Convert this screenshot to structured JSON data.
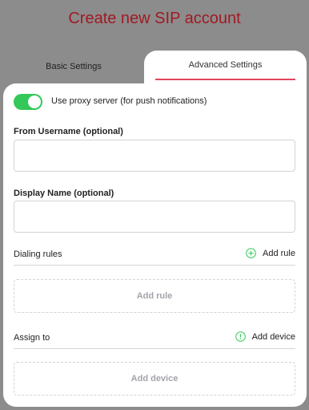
{
  "page_title": "Create new SIP account",
  "tabs": {
    "basic": "Basic Settings",
    "advanced": "Advanced Settings"
  },
  "proxy": {
    "label": "Use proxy server (for push notifications)",
    "enabled": true
  },
  "from_username": {
    "label": "From Username (optional)",
    "value": ""
  },
  "display_name": {
    "label": "Display Name (optional)",
    "value": ""
  },
  "dialing_rules": {
    "title": "Dialing rules",
    "action": "Add rule",
    "placeholder": "Add rule",
    "icon": "plus-circle-icon"
  },
  "assign_to": {
    "title": "Assign to",
    "action": "Add device",
    "placeholder": "Add device",
    "icon": "info-circle-icon"
  },
  "colors": {
    "title": "#a01a23",
    "accent": "#e4465e",
    "toggle_on": "#34c759",
    "icon_green": "#34c759",
    "overlay": "#8c8c8c"
  }
}
